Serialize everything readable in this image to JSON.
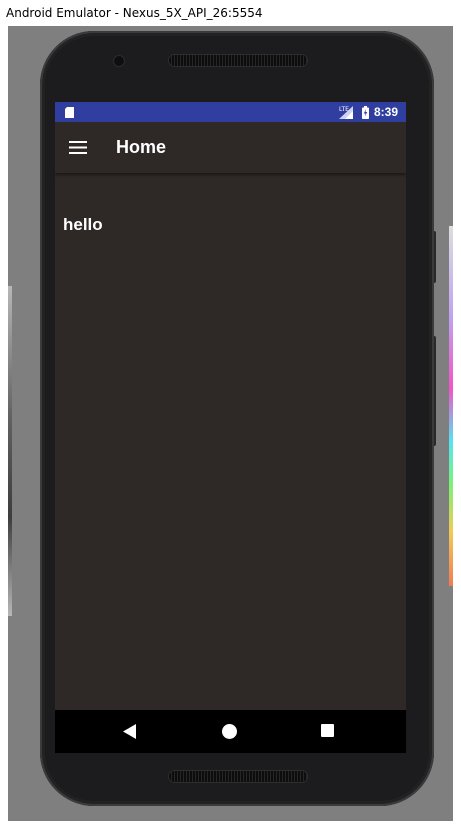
{
  "window": {
    "title": "Android Emulator - Nexus_5X_API_26:5554"
  },
  "status_bar": {
    "network_label": "LTE",
    "time": "8:39",
    "background_color": "#303f9f",
    "icons": [
      "sd-card-icon",
      "lte-signal-icon",
      "battery-charging-icon"
    ]
  },
  "toolbar": {
    "title": "Home",
    "menu_icon": "hamburger-menu-icon",
    "background_color": "#2e2926"
  },
  "content": {
    "text": "hello",
    "background_color": "#2e2926"
  },
  "nav_bar": {
    "buttons": [
      "back-icon",
      "home-icon",
      "recents-icon"
    ]
  }
}
